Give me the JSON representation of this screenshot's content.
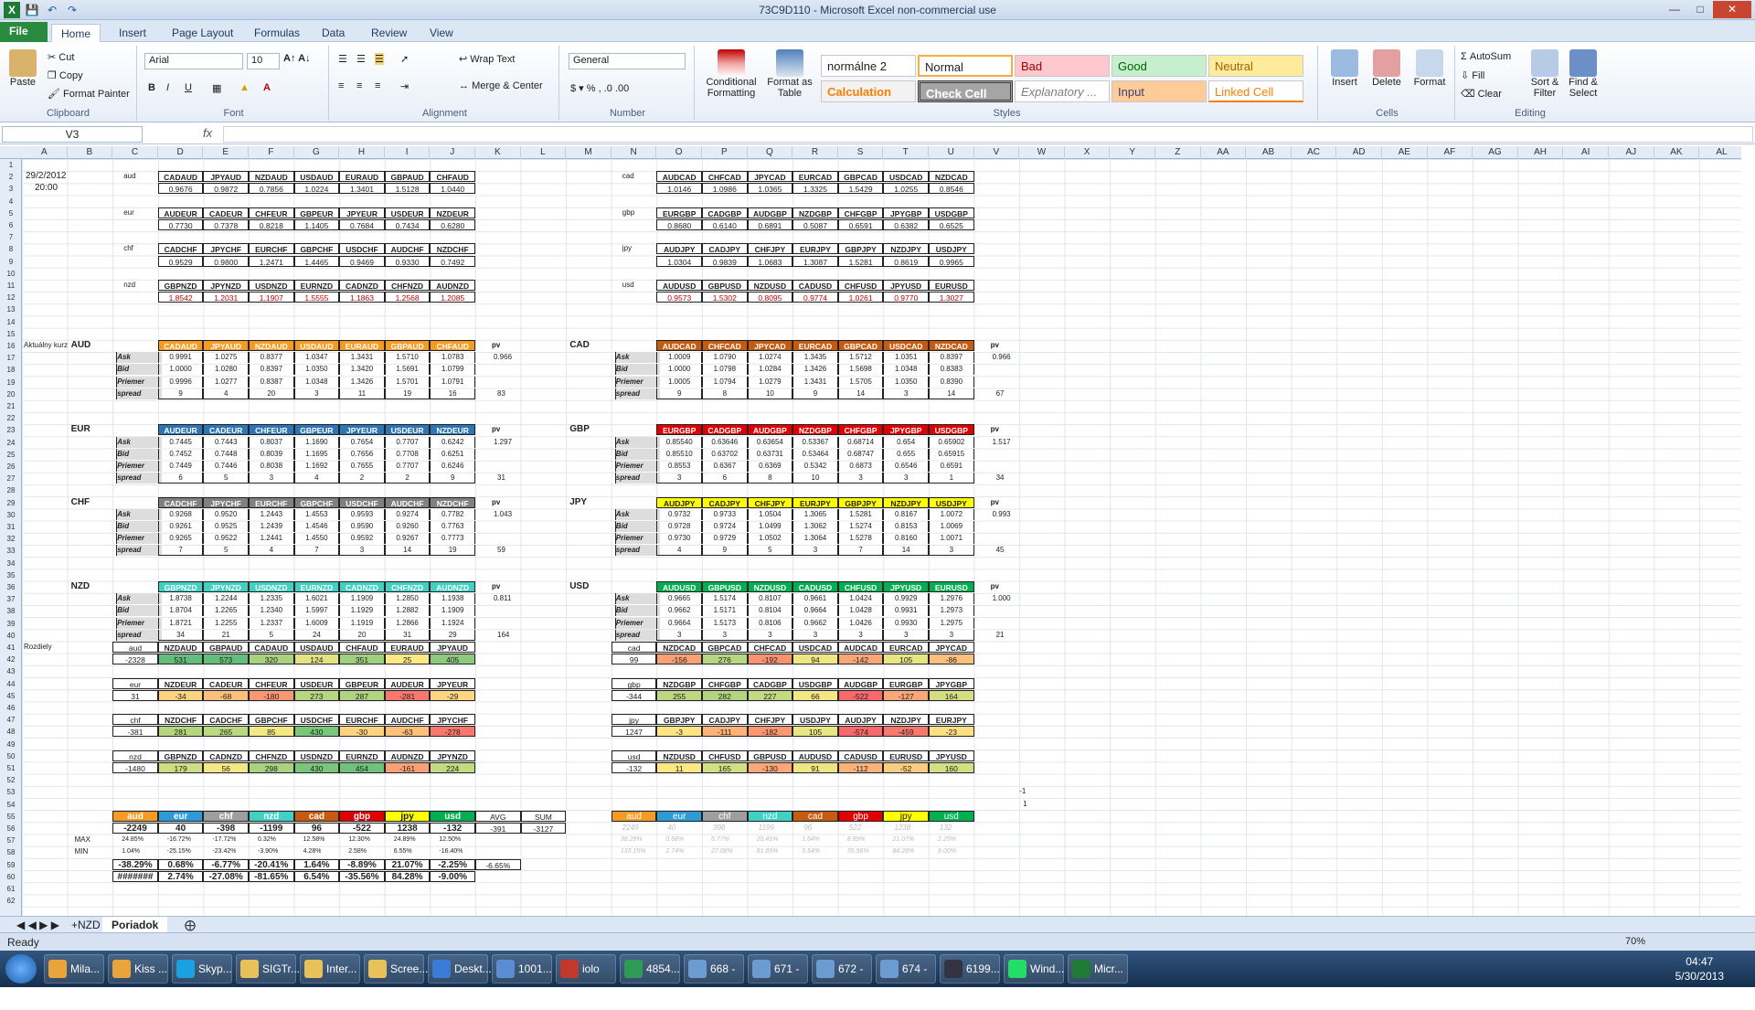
{
  "window": {
    "title": "73C9D110 - Microsoft Excel non-commercial use"
  },
  "tabs": [
    "File",
    "Home",
    "Insert",
    "Page Layout",
    "Formulas",
    "Data",
    "Review",
    "View"
  ],
  "ribbon": {
    "clipboard": {
      "label": "Clipboard",
      "paste": "Paste",
      "cut": "Cut",
      "copy": "Copy",
      "format_painter": "Format Painter"
    },
    "font": {
      "label": "Font",
      "family": "Arial",
      "size": "10"
    },
    "alignment": {
      "label": "Alignment",
      "wrap": "Wrap Text",
      "merge": "Merge & Center"
    },
    "number": {
      "label": "Number",
      "format": "General"
    },
    "styles": {
      "label": "Styles",
      "conditional": "Conditional Formatting",
      "format_table": "Format as Table",
      "cells": [
        "normálne 2",
        "Normal",
        "Bad",
        "Good",
        "Neutral",
        "Calculation",
        "Check Cell",
        "Explanatory ...",
        "Input",
        "Linked Cell"
      ]
    },
    "cells": {
      "label": "Cells",
      "insert": "Insert",
      "delete": "Delete",
      "format": "Format"
    },
    "editing": {
      "label": "Editing",
      "autosum": "AutoSum",
      "fill": "Fill",
      "clear": "Clear",
      "sort": "Sort & Filter",
      "find": "Find & Select"
    }
  },
  "formula_bar": {
    "name_box": "V3",
    "fx": "fx",
    "content": ""
  },
  "columns": [
    "A",
    "B",
    "C",
    "D",
    "E",
    "F",
    "G",
    "H",
    "I",
    "J",
    "K",
    "L",
    "M",
    "N",
    "O",
    "P",
    "Q",
    "R",
    "S",
    "T",
    "U",
    "V",
    "W",
    "X",
    "Y",
    "Z",
    "AA",
    "AB",
    "AC",
    "AD",
    "AE",
    "AF",
    "AG",
    "AH",
    "AI",
    "AJ",
    "AK",
    "AL",
    "AM"
  ],
  "sheet": {
    "date": "29/2/2012",
    "time": "20:00",
    "top_left": [
      {
        "lbl": "aud",
        "hdr": [
          "CADAUD",
          "JPYAUD",
          "NZDAUD",
          "USDAUD",
          "EURAUD",
          "GBPAUD",
          "CHFAUD"
        ],
        "val": [
          "0.9676",
          "0.9872",
          "0.7856",
          "1.0224",
          "1.3401",
          "1.5128",
          "1.0440"
        ]
      },
      {
        "lbl": "eur",
        "hdr": [
          "AUDEUR",
          "CADEUR",
          "CHFEUR",
          "GBPEUR",
          "JPYEUR",
          "USDEUR",
          "NZDEUR"
        ],
        "val": [
          "0.7730",
          "0.7378",
          "0.8218",
          "1.1405",
          "0.7684",
          "0.7434",
          "0.6280"
        ]
      },
      {
        "lbl": "chf",
        "hdr": [
          "CADCHF",
          "JPYCHF",
          "EURCHF",
          "GBPCHF",
          "USDCHF",
          "AUDCHF",
          "NZDCHF"
        ],
        "val": [
          "0.9529",
          "0.9800",
          "1.2471",
          "1.4465",
          "0.9469",
          "0.9330",
          "0.7492"
        ]
      },
      {
        "lbl": "nzd",
        "hdr": [
          "GBPNZD",
          "JPYNZD",
          "USDNZD",
          "EURNZD",
          "CADNZD",
          "CHFNZD",
          "AUDNZD"
        ],
        "val": [
          "1.8542",
          "1.2031",
          "1.1907",
          "1.5555",
          "1.1863",
          "1.2568",
          "1.2085"
        ]
      }
    ],
    "top_right": [
      {
        "lbl": "cad",
        "hdr": [
          "AUDCAD",
          "CHFCAD",
          "JPYCAD",
          "EURCAD",
          "GBPCAD",
          "USDCAD",
          "NZDCAD"
        ],
        "val": [
          "1.0146",
          "1.0986",
          "1.0365",
          "1.3325",
          "1.5429",
          "1.0255",
          "0.8546"
        ]
      },
      {
        "lbl": "gbp",
        "hdr": [
          "EURGBP",
          "CADGBP",
          "AUDGBP",
          "NZDGBP",
          "CHFGBP",
          "JPYGBP",
          "USDGBP"
        ],
        "val": [
          "0.8680",
          "0.6140",
          "0.6891",
          "0.5087",
          "0.6591",
          "0.6382",
          "0.6525"
        ]
      },
      {
        "lbl": "jpy",
        "hdr": [
          "AUDJPY",
          "CADJPY",
          "CHFJPY",
          "EURJPY",
          "GBPJPY",
          "NZDJPY",
          "USDJPY"
        ],
        "val": [
          "1.0304",
          "0.9839",
          "1.0683",
          "1.3087",
          "1.5281",
          "0.8619",
          "0.9965"
        ]
      },
      {
        "lbl": "usd",
        "hdr": [
          "AUDUSD",
          "GBPUSD",
          "NZDUSD",
          "CADUSD",
          "CHFUSD",
          "JPYUSD",
          "EURUSD"
        ],
        "val": [
          "0.9573",
          "1.5302",
          "0.8095",
          "0.9774",
          "1.0261",
          "0.9770",
          "1.3027"
        ]
      }
    ],
    "aktualny": "Aktuálny kurz",
    "rozdiely": "Rozdiely",
    "row_labels": [
      "Ask",
      "Bid",
      "Priemer",
      "spread"
    ],
    "pv_label": "pv",
    "mid_left": [
      {
        "cur": "AUD",
        "color": "#f59a23",
        "hdr": [
          "CADAUD",
          "JPYAUD",
          "NZDAUD",
          "USDAUD",
          "EURAUD",
          "GBPAUD",
          "CHFAUD"
        ],
        "ask": [
          "0.9991",
          "1.0275",
          "0.8377",
          "1.0347",
          "1.3431",
          "1.5710",
          "1.0783"
        ],
        "bid": [
          "1.0000",
          "1.0280",
          "0.8397",
          "1.0350",
          "1.3420",
          "1.5691",
          "1.0799"
        ],
        "avg": [
          "0.9996",
          "1.0277",
          "0.8387",
          "1.0348",
          "1.3426",
          "1.5701",
          "1.0791"
        ],
        "spread": [
          "9",
          "4",
          "20",
          "3",
          "11",
          "19",
          "16"
        ],
        "pv": "0.966",
        "sum": "83"
      },
      {
        "cur": "EUR",
        "color": "#2e75b6",
        "hdr": [
          "AUDEUR",
          "CADEUR",
          "CHFEUR",
          "GBPEUR",
          "JPYEUR",
          "USDEUR",
          "NZDEUR"
        ],
        "ask": [
          "0.7445",
          "0.7443",
          "0.8037",
          "1.1690",
          "0.7654",
          "0.7707",
          "0.6242"
        ],
        "bid": [
          "0.7452",
          "0.7448",
          "0.8039",
          "1.1695",
          "0.7656",
          "0.7708",
          "0.6251"
        ],
        "avg": [
          "0.7449",
          "0.7446",
          "0.8038",
          "1.1692",
          "0.7655",
          "0.7707",
          "0.6246"
        ],
        "spread": [
          "6",
          "5",
          "3",
          "4",
          "2",
          "2",
          "9"
        ],
        "pv": "1.297",
        "sum": "31"
      },
      {
        "cur": "CHF",
        "color": "#808080",
        "hdr": [
          "CADCHF",
          "JPYCHF",
          "EURCHF",
          "GBPCHF",
          "USDCHF",
          "AUDCHF",
          "NZDCHF"
        ],
        "ask": [
          "0.9268",
          "0.9520",
          "1.2443",
          "1.4553",
          "0.9593",
          "0.9274",
          "0.7782"
        ],
        "bid": [
          "0.9261",
          "0.9525",
          "1.2439",
          "1.4546",
          "0.9590",
          "0.9260",
          "0.7763"
        ],
        "avg": [
          "0.9265",
          "0.9522",
          "1.2441",
          "1.4550",
          "0.9592",
          "0.9267",
          "0.7773"
        ],
        "spread": [
          "7",
          "5",
          "4",
          "7",
          "3",
          "14",
          "19"
        ],
        "pv": "1.043",
        "sum": "59"
      },
      {
        "cur": "NZD",
        "color": "#3ed1c4",
        "hdr": [
          "GBPNZD",
          "JPYNZD",
          "USDNZD",
          "EURNZD",
          "CADNZD",
          "CHFNZD",
          "AUDNZD"
        ],
        "ask": [
          "1.8738",
          "1.2244",
          "1.2335",
          "1.6021",
          "1.1909",
          "1.2850",
          "1.1938"
        ],
        "bid": [
          "1.8704",
          "1.2265",
          "1.2340",
          "1.5997",
          "1.1929",
          "1.2882",
          "1.1909"
        ],
        "avg": [
          "1.8721",
          "1.2255",
          "1.2337",
          "1.6009",
          "1.1919",
          "1.2866",
          "1.1924"
        ],
        "spread": [
          "34",
          "21",
          "5",
          "24",
          "20",
          "31",
          "29"
        ],
        "pv": "0.811",
        "sum": "164"
      }
    ],
    "mid_right": [
      {
        "cur": "CAD",
        "color": "#c55a11",
        "hdr": [
          "AUDCAD",
          "CHFCAD",
          "JPYCAD",
          "EURCAD",
          "GBPCAD",
          "USDCAD",
          "NZDCAD"
        ],
        "ask": [
          "1.0009",
          "1.0790",
          "1.0274",
          "1.3435",
          "1.5712",
          "1.0351",
          "0.8397"
        ],
        "bid": [
          "1.0000",
          "1.0798",
          "1.0284",
          "1.3426",
          "1.5698",
          "1.0348",
          "0.8383"
        ],
        "avg": [
          "1.0005",
          "1.0794",
          "1.0279",
          "1.3431",
          "1.5705",
          "1.0350",
          "0.8390"
        ],
        "spread": [
          "9",
          "8",
          "10",
          "9",
          "14",
          "3",
          "14"
        ],
        "pv": "0.966",
        "sum": "67"
      },
      {
        "cur": "GBP",
        "color": "#e00000",
        "hdr": [
          "EURGBP",
          "CADGBP",
          "AUDGBP",
          "NZDGBP",
          "CHFGBP",
          "JPYGBP",
          "USDGBP"
        ],
        "ask": [
          "0.85540",
          "0.63646",
          "0.63654",
          "0.53367",
          "0.68714",
          "0.654",
          "0.65902"
        ],
        "bid": [
          "0.85510",
          "0.63702",
          "0.63731",
          "0.53464",
          "0.68747",
          "0.655",
          "0.65915"
        ],
        "avg": [
          "0.8553",
          "0.6367",
          "0.6369",
          "0.5342",
          "0.6873",
          "0.6546",
          "0.6591"
        ],
        "spread": [
          "3",
          "6",
          "8",
          "10",
          "3",
          "3",
          "1"
        ],
        "pv": "1.517",
        "sum": "34"
      },
      {
        "cur": "JPY",
        "color": "#ffff00",
        "hdr": [
          "AUDJPY",
          "CADJPY",
          "CHFJPY",
          "EURJPY",
          "GBPJPY",
          "NZDJPY",
          "USDJPY"
        ],
        "ask": [
          "0.9732",
          "0.9733",
          "1.0504",
          "1.3065",
          "1.5281",
          "0.8167",
          "1.0072"
        ],
        "bid": [
          "0.9728",
          "0.9724",
          "1.0499",
          "1.3062",
          "1.5274",
          "0.8153",
          "1.0069"
        ],
        "avg": [
          "0.9730",
          "0.9729",
          "1.0502",
          "1.3064",
          "1.5278",
          "0.8160",
          "1.0071"
        ],
        "spread": [
          "4",
          "9",
          "5",
          "3",
          "7",
          "14",
          "3"
        ],
        "pv": "0.993",
        "sum": "45"
      },
      {
        "cur": "USD",
        "color": "#00b050",
        "hdr": [
          "AUDUSD",
          "GBPUSD",
          "NZDUSD",
          "CADUSD",
          "CHFUSD",
          "JPYUSD",
          "EURUSD"
        ],
        "ask": [
          "0.9665",
          "1.5174",
          "0.8107",
          "0.9661",
          "1.0424",
          "0.9929",
          "1.2976"
        ],
        "bid": [
          "0.9662",
          "1.5171",
          "0.8104",
          "0.9664",
          "1.0428",
          "0.9931",
          "1.2973"
        ],
        "avg": [
          "0.9664",
          "1.5173",
          "0.8106",
          "0.9662",
          "1.0426",
          "0.9930",
          "1.2975"
        ],
        "spread": [
          "3",
          "3",
          "3",
          "3",
          "3",
          "3",
          "3"
        ],
        "pv": "1.000",
        "sum": "21"
      }
    ],
    "diff_left": [
      {
        "lbl": "aud",
        "tot": "-2328",
        "hdr": [
          "NZDAUD",
          "GBPAUD",
          "CADAUD",
          "USDAUD",
          "CHFAUD",
          "EURAUD",
          "JPYAUD"
        ],
        "val": [
          "531",
          "573",
          "320",
          "124",
          "351",
          "25",
          "405"
        ],
        "col": [
          "#63be7b",
          "#63be7b",
          "#a9d27f",
          "#e3e383",
          "#a0d07e",
          "#fde884",
          "#8dc97d"
        ]
      },
      {
        "lbl": "eur",
        "tot": "31",
        "hdr": [
          "NZDEUR",
          "CADEUR",
          "CHFEUR",
          "USDEUR",
          "GBPEUR",
          "AUDEUR",
          "JPYEUR"
        ],
        "val": [
          "-34",
          "-68",
          "-180",
          "273",
          "287",
          "-281",
          "-29"
        ],
        "col": [
          "#fed37f",
          "#fcc07b",
          "#fa9773",
          "#b7d680",
          "#b0d47f",
          "#f8786e",
          "#fed580"
        ]
      },
      {
        "lbl": "chf",
        "tot": "-381",
        "hdr": [
          "NZDCHF",
          "CADCHF",
          "GBPCHF",
          "USDCHF",
          "EURCHF",
          "AUDCHF",
          "JPYCHF"
        ],
        "val": [
          "281",
          "265",
          "85",
          "430",
          "-30",
          "-63",
          "-278"
        ],
        "col": [
          "#b3d57f",
          "#bad781",
          "#f3e884",
          "#7ac67b",
          "#fed480",
          "#fcc27b",
          "#f8786e"
        ]
      },
      {
        "lbl": "nzd",
        "tot": "-1480",
        "hdr": [
          "GBPNZD",
          "CADNZD",
          "CHFNZD",
          "USDNZD",
          "EURNZD",
          "AUDNZD",
          "JPYNZD"
        ],
        "val": [
          "179",
          "56",
          "298",
          "430",
          "454",
          "-161",
          "224"
        ],
        "col": [
          "#d0de82",
          "#f3e884",
          "#a9d27f",
          "#7ac67b",
          "#6ec27a",
          "#f9a175",
          "#c4da81"
        ]
      }
    ],
    "diff_right": [
      {
        "lbl": "cad",
        "tot": "99",
        "hdr": [
          "NZDCAD",
          "GBPCAD",
          "CHFCAD",
          "USDCAD",
          "AUDCAD",
          "EURCAD",
          "JPYCAD"
        ],
        "val": [
          "-156",
          "276",
          "-192",
          "94",
          "-142",
          "105",
          "-86"
        ],
        "col": [
          "#f9a175",
          "#b7d680",
          "#f9936f",
          "#ede683",
          "#faa776",
          "#e8e583",
          "#fdc07c"
        ]
      },
      {
        "lbl": "gbp",
        "tot": "-344",
        "hdr": [
          "NZDGBP",
          "CHFGBP",
          "CADGBP",
          "USDGBP",
          "AUDGBP",
          "EURGBP",
          "JPYGBP"
        ],
        "val": [
          "255",
          "282",
          "227",
          "66",
          "-522",
          "-127",
          "164"
        ],
        "col": [
          "#bdd881",
          "#b3d57f",
          "#c4da81",
          "#f3e884",
          "#f8696b",
          "#fba777",
          "#d4df82"
        ]
      },
      {
        "lbl": "jpy",
        "tot": "1247",
        "hdr": [
          "GBPJPY",
          "CADJPY",
          "CHFJPY",
          "USDJPY",
          "AUDJPY",
          "NZDJPY",
          "EURJPY"
        ],
        "val": [
          "-3",
          "-111",
          "-182",
          "105",
          "-574",
          "-459",
          "-23"
        ],
        "col": [
          "#fee482",
          "#fcb279",
          "#fa9773",
          "#e8e583",
          "#f8696b",
          "#f8786e",
          "#fedf81"
        ]
      },
      {
        "lbl": "usd",
        "tot": "-132",
        "hdr": [
          "NZDUSD",
          "CHFUSD",
          "GBPUSD",
          "AUDUSD",
          "CADUSD",
          "EURUSD",
          "JPYUSD"
        ],
        "val": [
          "11",
          "165",
          "-130",
          "91",
          "-112",
          "-52",
          "160"
        ],
        "col": [
          "#fde884",
          "#d4df82",
          "#fba777",
          "#ede683",
          "#fcb279",
          "#fdcc7e",
          "#d4df82"
        ]
      }
    ],
    "summary_left": {
      "hdr": [
        "aud",
        "eur",
        "chf",
        "nzd",
        "cad",
        "gbp",
        "jpy",
        "usd"
      ],
      "hdrcol": [
        "#f59a23",
        "#2e9bd6",
        "#9e9e9e",
        "#3ed1c4",
        "#c55a11",
        "#e00000",
        "#ffff00",
        "#00b050"
      ],
      "row1": [
        "-2249",
        "40",
        "-398",
        "-1199",
        "96",
        "-522",
        "1238",
        "-132"
      ],
      "avg_lbl": "AVG",
      "sum_lbl": "SUM",
      "avg": "-391",
      "sum": "-3127",
      "max_lbl": "MAX",
      "min_lbl": "MIN",
      "max": [
        "24.85%",
        "-16.72%",
        "-17.72%",
        "0.32%",
        "12.58%",
        "12.30%",
        "24.89%",
        "12.50%"
      ],
      "min": [
        "1.04%",
        "-25.15%",
        "-23.42%",
        "-3.90%",
        "4.28%",
        "2.58%",
        "6.55%",
        "-16.40%"
      ],
      "pct": [
        "-38.29%",
        "0.68%",
        "-6.77%",
        "-20.41%",
        "1.64%",
        "-8.89%",
        "21.07%",
        "-2.25%"
      ],
      "pct_extra": "-6.65%",
      "last": [
        "#######",
        "2.74%",
        "-27.08%",
        "-81.65%",
        "6.54%",
        "-35.56%",
        "84.28%",
        "-9.00%"
      ]
    },
    "summary_right": {
      "row1": [
        "2249",
        "40",
        "398",
        "1199",
        "96",
        "522",
        "1238",
        "132"
      ],
      "max": [
        "38.29%",
        "0.68%",
        "6.77%",
        "20.41%",
        "1.64%",
        "8.89%",
        "21.07%",
        "2.25%"
      ],
      "min": [
        "133.15%",
        "2.74%",
        "27.08%",
        "81.65%",
        "6.54%",
        "35.56%",
        "84.28%",
        "9.00%"
      ]
    },
    "misc": [
      "-1",
      "1"
    ]
  },
  "sheet_tabs": [
    "+NZD",
    "Poriadok"
  ],
  "status": {
    "ready": "Ready",
    "zoom": "70%"
  },
  "taskbar": {
    "items": [
      "Mila...",
      "Kiss ...",
      "Skyp...",
      "SIGTr...",
      "Inter...",
      "Scree...",
      "Deskt...",
      "1001...",
      "iolo S...",
      "4854...",
      "668 - ...",
      "671 - ...",
      "672 - ...",
      "674 - ...",
      "6199...",
      "Wind...",
      "Micr..."
    ],
    "time": "04:47",
    "date": "5/30/2013"
  }
}
